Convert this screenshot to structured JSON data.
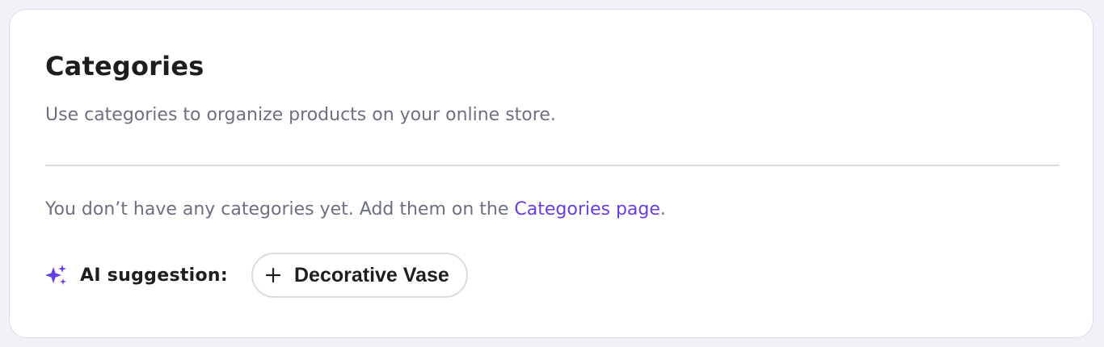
{
  "section": {
    "title": "Categories",
    "subtitle": "Use categories to organize products on your online store."
  },
  "empty_state": {
    "message_prefix": "You don’t have any categories yet. Add them on the ",
    "link_label": "Categories page",
    "message_suffix": "."
  },
  "ai_suggestion": {
    "label": "AI suggestion:",
    "icon": "sparkle-icon",
    "chip": {
      "icon": "plus-icon",
      "label": "Decorative Vase"
    }
  },
  "colors": {
    "accent": "#673de6",
    "text_primary": "#1d1e20",
    "text_secondary": "#6d7081",
    "border": "#dadce0",
    "background": "#f1f2f7"
  }
}
